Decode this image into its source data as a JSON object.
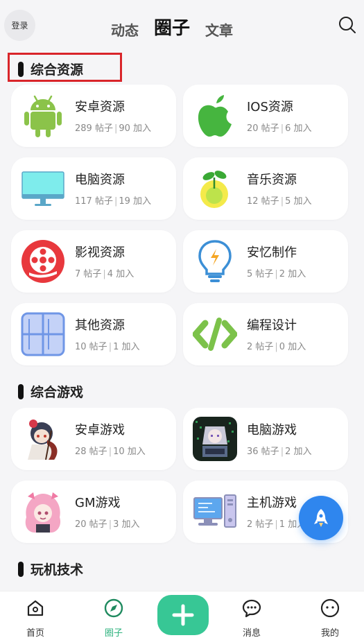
{
  "header": {
    "login_label": "登录",
    "tabs": [
      "动态",
      "圈子",
      "文章"
    ],
    "active_tab": "圈子"
  },
  "sections": [
    {
      "title": "综合资源",
      "cards": [
        {
          "name": "安卓资源",
          "posts": "289 帖子",
          "members": "90 加入",
          "icon": "android-icon"
        },
        {
          "name": "IOS资源",
          "posts": "20 帖子",
          "members": "6 加入",
          "icon": "apple-icon"
        },
        {
          "name": "电脑资源",
          "posts": "117 帖子",
          "members": "19 加入",
          "icon": "monitor-icon"
        },
        {
          "name": "音乐资源",
          "posts": "12 帖子",
          "members": "5 加入",
          "icon": "music-sprout-icon"
        },
        {
          "name": "影视资源",
          "posts": "7 帖子",
          "members": "4 加入",
          "icon": "film-reel-icon"
        },
        {
          "name": "安忆制作",
          "posts": "5 帖子",
          "members": "2 加入",
          "icon": "lightbulb-icon"
        },
        {
          "name": "其他资源",
          "posts": "10 帖子",
          "members": "1 加入",
          "icon": "grid-icon"
        },
        {
          "name": "编程设计",
          "posts": "2 帖子",
          "members": "0 加入",
          "icon": "code-icon"
        }
      ]
    },
    {
      "title": "综合游戏",
      "cards": [
        {
          "name": "安卓游戏",
          "posts": "28 帖子",
          "members": "10 加入",
          "icon": "anime-character-icon"
        },
        {
          "name": "电脑游戏",
          "posts": "36 帖子",
          "members": "2 加入",
          "icon": "pixel-character-icon"
        },
        {
          "name": "GM游戏",
          "posts": "20 帖子",
          "members": "3 加入",
          "icon": "anime-girl-icon"
        },
        {
          "name": "主机游戏",
          "posts": "2 帖子",
          "members": "1 加入",
          "icon": "computer-console-icon"
        }
      ]
    },
    {
      "title": "玩机技术"
    }
  ],
  "nav": {
    "items": [
      {
        "label": "首页",
        "icon": "home-icon"
      },
      {
        "label": "圈子",
        "icon": "compass-icon"
      },
      {
        "label": "消息",
        "icon": "chat-icon"
      },
      {
        "label": "我的",
        "icon": "profile-icon"
      }
    ],
    "active": "圈子",
    "accent": "#37c795"
  },
  "colors": {
    "highlight_border": "#d9252a",
    "fab": "#2f86ee"
  }
}
